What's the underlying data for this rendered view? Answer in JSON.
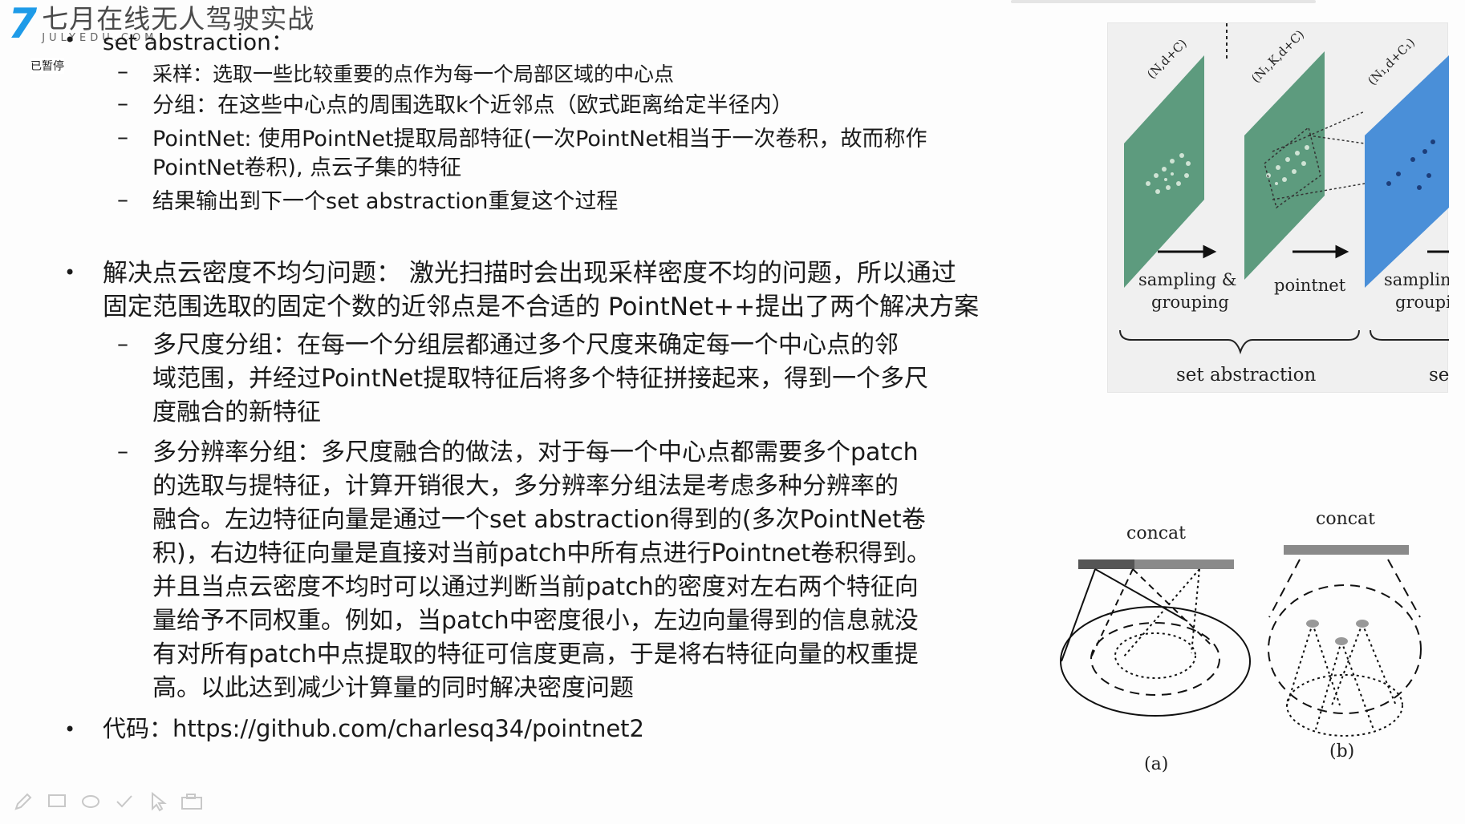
{
  "header": {
    "logo_mark": "7",
    "brand_title": "七月在线无人驾驶实战",
    "brand_sub": "JULYEDU.COM",
    "pause_label": "已暂停"
  },
  "slide": {
    "set_abstraction": {
      "title": "set abstraction：",
      "items": [
        "采样：选取一些比较重要的点作为每一个局部区域的中心点",
        "分组：在这些中心点的周围选取k个近邻点（欧式距离给定半径内）",
        "PointNet: 使用PointNet提取局部特征(一次PointNet相当于一次卷积，故而称作",
        "PointNet卷积), 点云子集的特征",
        "结果输出到下一个set abstraction重复这个过程"
      ]
    },
    "density": {
      "line1": "解决点云密度不均匀问题：  激光扫描时会出现采样密度不均的问题，所以通过",
      "line2": "固定范围选取的固定个数的近邻点是不合适的 PointNet++提出了两个解决方案",
      "msg_lines": [
        "多尺度分组：在每一个分组层都通过多个尺度来确定每一个中心点的邻",
        "域范围，并经过PointNet提取特征后将多个特征拼接起来，得到一个多尺",
        "度融合的新特征"
      ],
      "mrg_lines": [
        "多分辨率分组：多尺度融合的做法，对于每一个中心点都需要多个patch",
        "的选取与提特征，计算开销很大，多分辨率分组法是考虑多种分辨率的",
        "融合。左边特征向量是通过一个set abstraction得到的(多次PointNet卷",
        "积)，右边特征向量是直接对当前patch中所有点进行Pointnet卷积得到。",
        "并且当点云密度不均时可以通过判断当前patch的密度对左右两个特征向",
        "量给予不同权重。例如，当patch中密度很小，左边向量得到的信息就没",
        "有对所有patch中点提取的特征可信度更高，于是将右特征向量的权重提",
        "高。以此达到减少计算量的同时解决密度问题"
      ]
    },
    "code": {
      "label": "代码：",
      "url": "https://github.com/charlesq34/pointnet2"
    }
  },
  "figure_top": {
    "plane_labels": [
      "(N,d+C)",
      "(N₁,K,d+C)",
      "(N₁,d+C₁)"
    ],
    "step_labels": [
      "sampling &",
      "grouping",
      "pointnet",
      "samplin",
      "groupi"
    ],
    "brace_label": "set abstraction",
    "brace_label_cut": "se",
    "colors": {
      "green": "#5d9b7e",
      "blue": "#4a8fd8"
    }
  },
  "figure_bottom": {
    "concat_a": "concat",
    "concat_b": "concat",
    "caption_a": "(a)",
    "caption_b": "(b)"
  }
}
